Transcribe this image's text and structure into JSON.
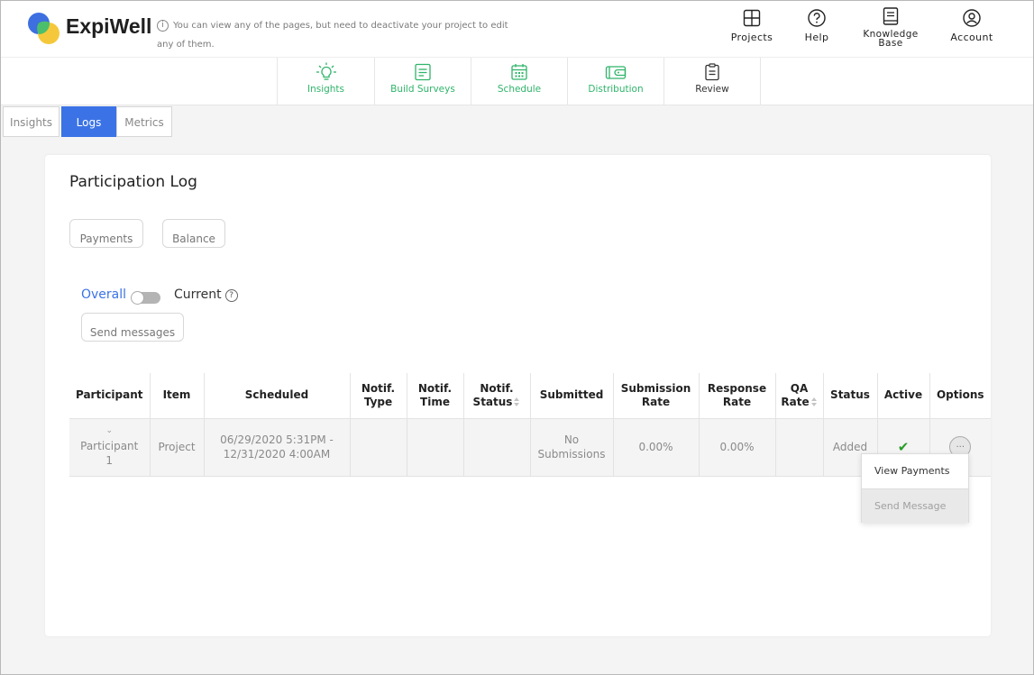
{
  "header": {
    "brand": "ExpiWell",
    "notice_line1": "You can view any of the pages, but need to deactivate your project to edit",
    "notice_line2": "any of them.",
    "notice_icon": "info-icon",
    "nav": [
      {
        "label": "Projects",
        "icon": "projects-grid-icon"
      },
      {
        "label": "Help",
        "icon": "help-circle-icon"
      },
      {
        "label_line1": "Knowledge",
        "label_line2": "Base",
        "icon": "book-icon"
      },
      {
        "label": "Account",
        "icon": "account-icon"
      }
    ]
  },
  "steps": [
    {
      "label": "Insights",
      "icon": "lightbulb-icon",
      "color": "#2fb46a"
    },
    {
      "label": "Build Surveys",
      "icon": "document-icon",
      "color": "#2fb46a"
    },
    {
      "label": "Schedule",
      "icon": "calendar-icon",
      "color": "#2fb46a"
    },
    {
      "label": "Distribution",
      "icon": "wallet-icon",
      "color": "#2fb46a"
    },
    {
      "label": "Review",
      "icon": "clipboard-icon",
      "color": "#333333"
    }
  ],
  "tabs": [
    {
      "label": "Insights",
      "active": false
    },
    {
      "label": "Logs",
      "active": true
    },
    {
      "label": "Metrics",
      "active": false
    }
  ],
  "page": {
    "title": "Participation Log",
    "payments_label": "Payments",
    "balance_label": "Balance",
    "overall_label": "Overall",
    "current_label": "Current",
    "send_messages_label": "Send messages"
  },
  "table": {
    "headers": {
      "participant": "Participant",
      "item": "Item",
      "scheduled": "Scheduled",
      "notif_type_1": "Notif.",
      "notif_type_2": "Type",
      "notif_time_1": "Notif.",
      "notif_time_2": "Time",
      "notif_status_1": "Notif.",
      "notif_status_2": "Status",
      "submitted": "Submitted",
      "submission_rate_1": "Submission",
      "submission_rate_2": "Rate",
      "response_rate_1": "Response",
      "response_rate_2": "Rate",
      "qa_rate_1": "QA",
      "qa_rate_2": "Rate",
      "status": "Status",
      "active": "Active",
      "options": "Options"
    },
    "row": {
      "participant_line1": "Participant",
      "participant_line2": "1",
      "item": "Project",
      "scheduled_line1": "06/29/2020 5:31PM -",
      "scheduled_line2": "12/31/2020 4:00AM",
      "notif_type": "",
      "notif_time": "",
      "notif_status": "",
      "submitted_line1": "No",
      "submitted_line2": "Submissions",
      "submission_rate": "0.00%",
      "response_rate": "0.00%",
      "qa_rate": "",
      "status": "Added",
      "active_icon": "check-icon",
      "options_label": "..."
    }
  },
  "options_menu": {
    "items": [
      {
        "label": "View Payments",
        "disabled": false
      },
      {
        "label": "Send Message",
        "disabled": true
      }
    ]
  },
  "colors": {
    "accent_blue": "#3b73e6",
    "step_green": "#2fb46a",
    "check_green": "#2a9d2a"
  }
}
